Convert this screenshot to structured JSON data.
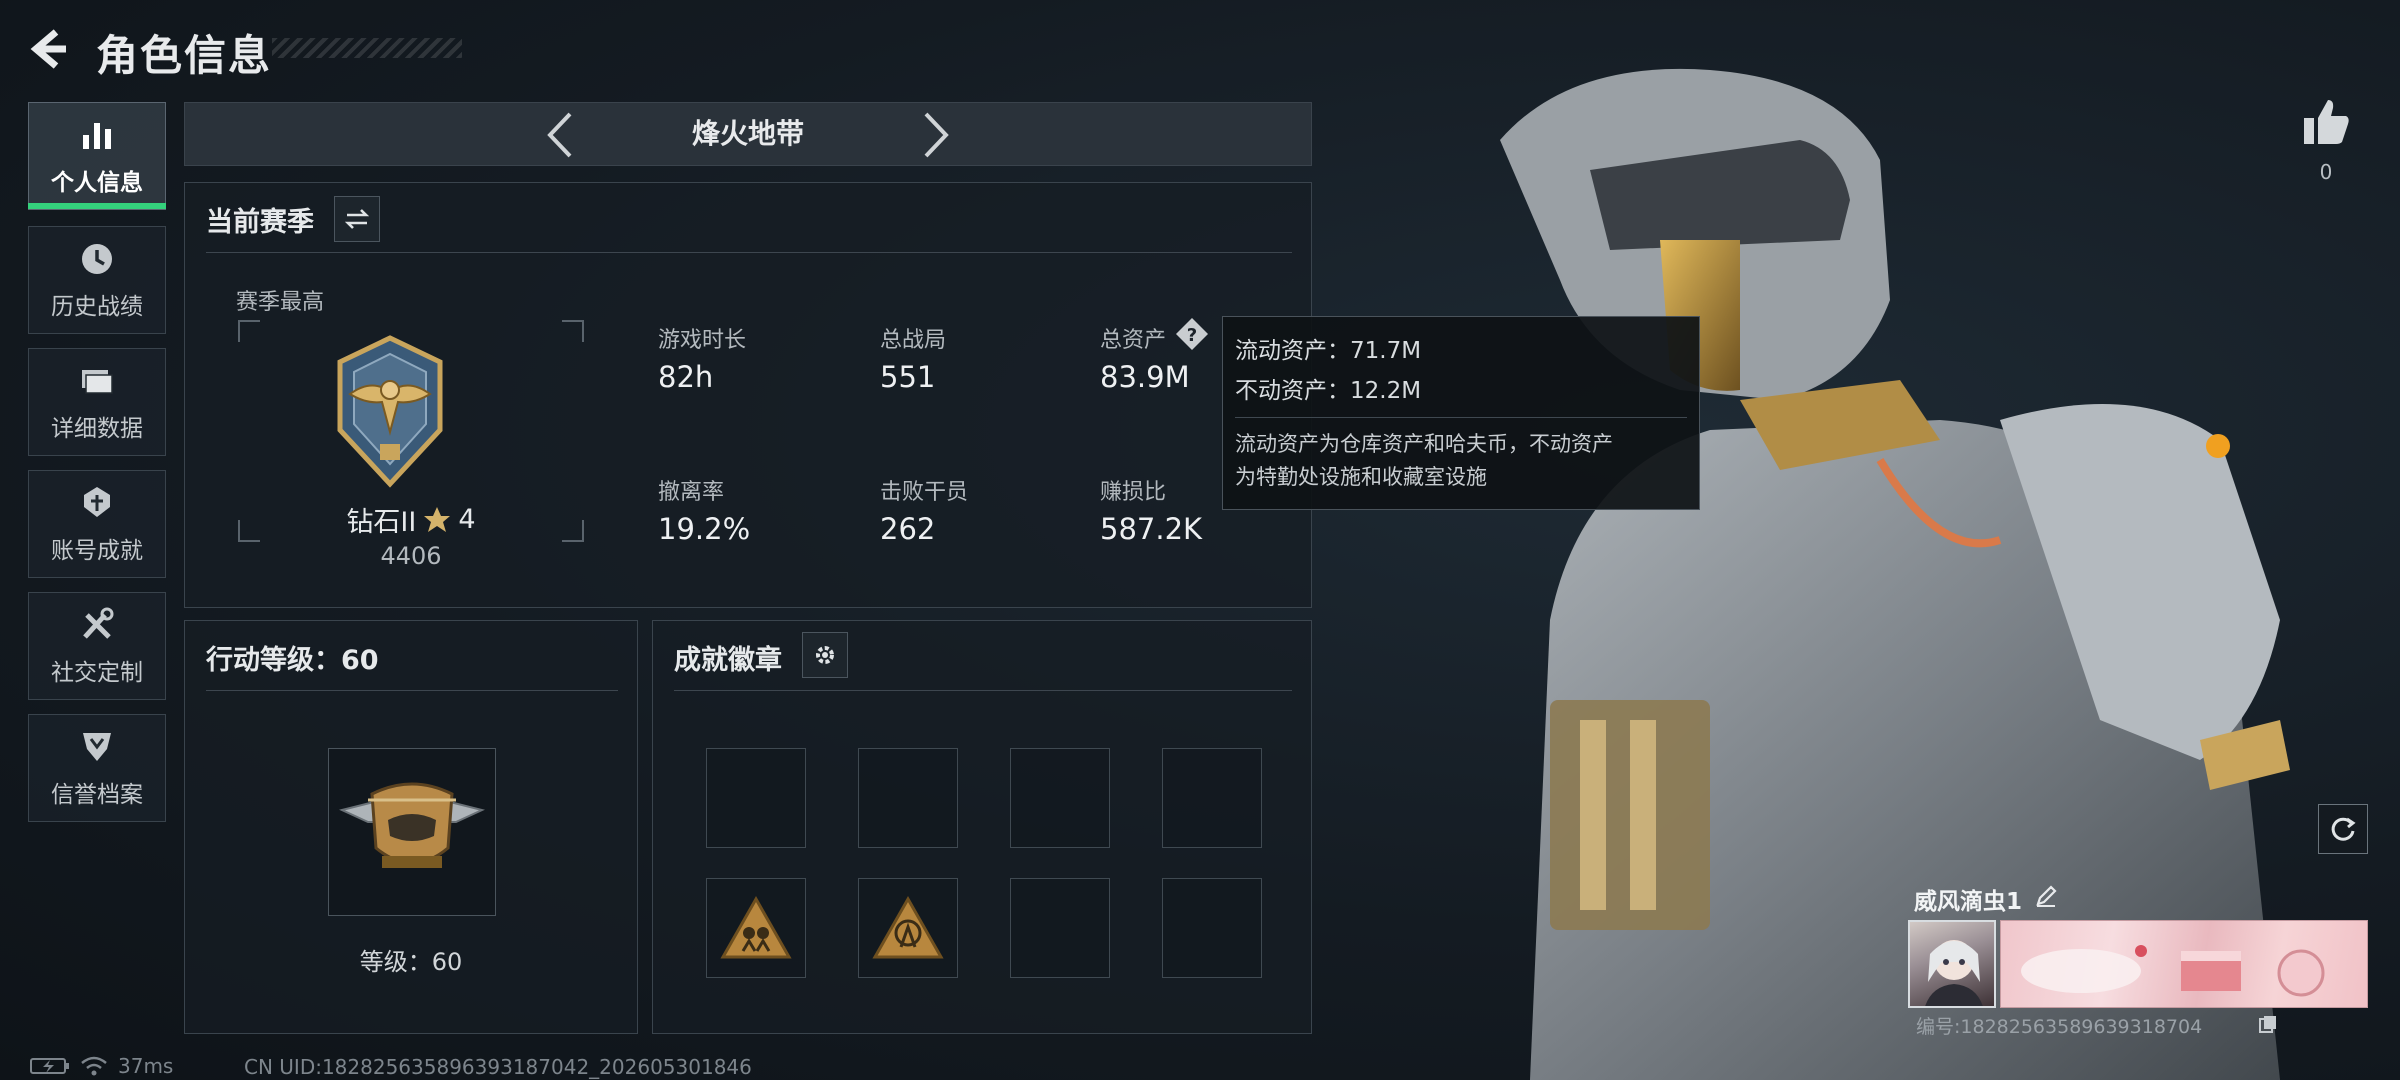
{
  "header": {
    "title": "角色信息"
  },
  "sidebar": {
    "items": [
      {
        "label": "个人信息",
        "icon": "bar-chart-icon",
        "active": true
      },
      {
        "label": "历史战绩",
        "icon": "clock-icon"
      },
      {
        "label": "详细数据",
        "icon": "folder-icon"
      },
      {
        "label": "账号成就",
        "icon": "trophy-icon"
      },
      {
        "label": "社交定制",
        "icon": "tools-icon"
      },
      {
        "label": "信誉档案",
        "icon": "shield-badge-icon"
      }
    ]
  },
  "mode": {
    "title": "烽火地带"
  },
  "season": {
    "title": "当前赛季",
    "best_label": "赛季最高",
    "rank_name": "钻石II",
    "rank_stars": "4",
    "rank_score": "4406",
    "stats": [
      {
        "label": "游戏时长",
        "value": "82h"
      },
      {
        "label": "总战局",
        "value": "551"
      },
      {
        "label": "总资产",
        "value": "83.9M"
      },
      {
        "label": "撤离率",
        "value": "19.2%"
      },
      {
        "label": "击败干员",
        "value": "262"
      },
      {
        "label": "赚损比",
        "value": "587.2K"
      }
    ]
  },
  "tooltip": {
    "liquid": "流动资产：71.7M",
    "fixed": "不动资产：12.2M",
    "desc_line1": "流动资产为仓库资产和哈夫币，不动资产",
    "desc_line2": "为特勤处设施和收藏室设施"
  },
  "action_level": {
    "title": "行动等级：60",
    "level_label": "等级：60"
  },
  "achievements": {
    "title": "成就徽章",
    "slots_filled": 2,
    "slots_total": 8
  },
  "profile": {
    "likes": "0",
    "nickname": "威风滴虫1",
    "id_text": "编号:18282563589639318704"
  },
  "status_bar": {
    "ping": "37ms",
    "uid": "CN UID:18282563589639318704​2_202605301846"
  },
  "colors": {
    "accent_green": "#34d17c",
    "gold": "#c9a55c"
  }
}
